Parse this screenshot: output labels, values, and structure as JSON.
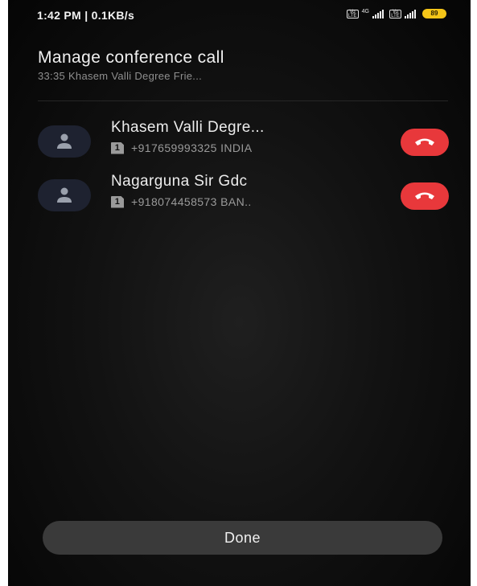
{
  "status_bar": {
    "time_speed": "1:42 PM | 0.1KB/s",
    "volte_label": "Vo LTE",
    "network_label": "4G",
    "battery_level": "89"
  },
  "header": {
    "title": "Manage conference call",
    "subtitle": "33:35  Khasem Valli Degree Frie..."
  },
  "participants": [
    {
      "name": "Khasem Valli Degre...",
      "sim": "1",
      "number": "+917659993325  INDIA"
    },
    {
      "name": "Nagarguna Sir Gdc",
      "sim": "1",
      "number": "+918074458573  BAN.."
    }
  ],
  "footer": {
    "done_label": "Done"
  },
  "colors": {
    "hangup": "#e8383b",
    "battery": "#f5c518",
    "background": "#121212"
  }
}
